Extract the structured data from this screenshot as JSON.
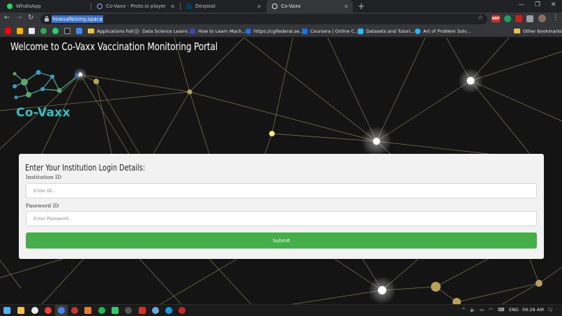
{
  "browser": {
    "tabs": [
      {
        "title": "WhatsApp",
        "active": false
      },
      {
        "title": "Co-Vaxx - Proto.io player",
        "active": false
      },
      {
        "title": "Devpost",
        "active": false
      },
      {
        "title": "Co-Vaxx",
        "active": true
      }
    ],
    "new_tab_symbol": "+",
    "window_controls": {
      "minimize": "—",
      "restore": "❐",
      "close": "✕"
    },
    "nav": {
      "back": "←",
      "forward": "→",
      "reload": "↻"
    },
    "address": "howsafeismy.space",
    "bookmark_star": "☆",
    "menu_symbol": "⋮",
    "bookmarks": [
      {
        "label": "Applications Fall",
        "icon": "folder-icon"
      },
      {
        "label": "Data Science Learni...",
        "icon": "bookmark-icon"
      },
      {
        "label": "How to Learn Mach...",
        "icon": "bookmark-icon"
      },
      {
        "label": "https://cgifederal.se...",
        "icon": "bookmark-icon"
      },
      {
        "label": "Coursera | Online C...",
        "icon": "bookmark-icon"
      },
      {
        "label": "Datasets and Tutori...",
        "icon": "bookmark-icon"
      },
      {
        "label": "Art of Problem Solv...",
        "icon": "bookmark-icon"
      }
    ],
    "other_bookmarks": "Other bookmarks",
    "colors": {
      "tabbar": "#202124",
      "toolbar": "#35363a",
      "url_highlight": "#3b6fc4"
    }
  },
  "page": {
    "title": "Welcome to Co-Vaxx Vaccination Monitoring Portal",
    "logo_text": "Co-Vaxx",
    "form": {
      "heading": "Enter Your Institution Login Details:",
      "institution_label": "Institution ID",
      "institution_placeholder": "Enter ID..",
      "password_label": "Password ID",
      "password_placeholder": "Enter Password..",
      "submit_label": "Submit"
    },
    "colors": {
      "accent": "#45ad4a",
      "logo": "#2ec4c4",
      "card": "#f2f2f2",
      "background": "#141414"
    }
  },
  "taskbar": {
    "tray_caret": "^",
    "language": "ENG",
    "time": "09:28 AM",
    "notification_symbol": "🗨"
  }
}
